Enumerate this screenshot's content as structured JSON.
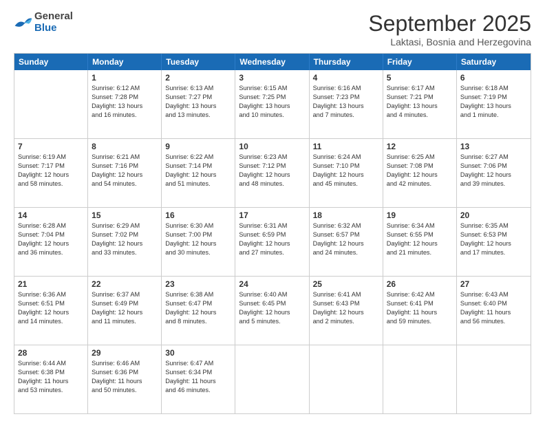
{
  "header": {
    "logo_general": "General",
    "logo_blue": "Blue",
    "month_title": "September 2025",
    "subtitle": "Laktasi, Bosnia and Herzegovina"
  },
  "weekdays": [
    "Sunday",
    "Monday",
    "Tuesday",
    "Wednesday",
    "Thursday",
    "Friday",
    "Saturday"
  ],
  "rows": [
    [
      {
        "day": "",
        "lines": []
      },
      {
        "day": "1",
        "lines": [
          "Sunrise: 6:12 AM",
          "Sunset: 7:28 PM",
          "Daylight: 13 hours",
          "and 16 minutes."
        ]
      },
      {
        "day": "2",
        "lines": [
          "Sunrise: 6:13 AM",
          "Sunset: 7:27 PM",
          "Daylight: 13 hours",
          "and 13 minutes."
        ]
      },
      {
        "day": "3",
        "lines": [
          "Sunrise: 6:15 AM",
          "Sunset: 7:25 PM",
          "Daylight: 13 hours",
          "and 10 minutes."
        ]
      },
      {
        "day": "4",
        "lines": [
          "Sunrise: 6:16 AM",
          "Sunset: 7:23 PM",
          "Daylight: 13 hours",
          "and 7 minutes."
        ]
      },
      {
        "day": "5",
        "lines": [
          "Sunrise: 6:17 AM",
          "Sunset: 7:21 PM",
          "Daylight: 13 hours",
          "and 4 minutes."
        ]
      },
      {
        "day": "6",
        "lines": [
          "Sunrise: 6:18 AM",
          "Sunset: 7:19 PM",
          "Daylight: 13 hours",
          "and 1 minute."
        ]
      }
    ],
    [
      {
        "day": "7",
        "lines": [
          "Sunrise: 6:19 AM",
          "Sunset: 7:17 PM",
          "Daylight: 12 hours",
          "and 58 minutes."
        ]
      },
      {
        "day": "8",
        "lines": [
          "Sunrise: 6:21 AM",
          "Sunset: 7:16 PM",
          "Daylight: 12 hours",
          "and 54 minutes."
        ]
      },
      {
        "day": "9",
        "lines": [
          "Sunrise: 6:22 AM",
          "Sunset: 7:14 PM",
          "Daylight: 12 hours",
          "and 51 minutes."
        ]
      },
      {
        "day": "10",
        "lines": [
          "Sunrise: 6:23 AM",
          "Sunset: 7:12 PM",
          "Daylight: 12 hours",
          "and 48 minutes."
        ]
      },
      {
        "day": "11",
        "lines": [
          "Sunrise: 6:24 AM",
          "Sunset: 7:10 PM",
          "Daylight: 12 hours",
          "and 45 minutes."
        ]
      },
      {
        "day": "12",
        "lines": [
          "Sunrise: 6:25 AM",
          "Sunset: 7:08 PM",
          "Daylight: 12 hours",
          "and 42 minutes."
        ]
      },
      {
        "day": "13",
        "lines": [
          "Sunrise: 6:27 AM",
          "Sunset: 7:06 PM",
          "Daylight: 12 hours",
          "and 39 minutes."
        ]
      }
    ],
    [
      {
        "day": "14",
        "lines": [
          "Sunrise: 6:28 AM",
          "Sunset: 7:04 PM",
          "Daylight: 12 hours",
          "and 36 minutes."
        ]
      },
      {
        "day": "15",
        "lines": [
          "Sunrise: 6:29 AM",
          "Sunset: 7:02 PM",
          "Daylight: 12 hours",
          "and 33 minutes."
        ]
      },
      {
        "day": "16",
        "lines": [
          "Sunrise: 6:30 AM",
          "Sunset: 7:00 PM",
          "Daylight: 12 hours",
          "and 30 minutes."
        ]
      },
      {
        "day": "17",
        "lines": [
          "Sunrise: 6:31 AM",
          "Sunset: 6:59 PM",
          "Daylight: 12 hours",
          "and 27 minutes."
        ]
      },
      {
        "day": "18",
        "lines": [
          "Sunrise: 6:32 AM",
          "Sunset: 6:57 PM",
          "Daylight: 12 hours",
          "and 24 minutes."
        ]
      },
      {
        "day": "19",
        "lines": [
          "Sunrise: 6:34 AM",
          "Sunset: 6:55 PM",
          "Daylight: 12 hours",
          "and 21 minutes."
        ]
      },
      {
        "day": "20",
        "lines": [
          "Sunrise: 6:35 AM",
          "Sunset: 6:53 PM",
          "Daylight: 12 hours",
          "and 17 minutes."
        ]
      }
    ],
    [
      {
        "day": "21",
        "lines": [
          "Sunrise: 6:36 AM",
          "Sunset: 6:51 PM",
          "Daylight: 12 hours",
          "and 14 minutes."
        ]
      },
      {
        "day": "22",
        "lines": [
          "Sunrise: 6:37 AM",
          "Sunset: 6:49 PM",
          "Daylight: 12 hours",
          "and 11 minutes."
        ]
      },
      {
        "day": "23",
        "lines": [
          "Sunrise: 6:38 AM",
          "Sunset: 6:47 PM",
          "Daylight: 12 hours",
          "and 8 minutes."
        ]
      },
      {
        "day": "24",
        "lines": [
          "Sunrise: 6:40 AM",
          "Sunset: 6:45 PM",
          "Daylight: 12 hours",
          "and 5 minutes."
        ]
      },
      {
        "day": "25",
        "lines": [
          "Sunrise: 6:41 AM",
          "Sunset: 6:43 PM",
          "Daylight: 12 hours",
          "and 2 minutes."
        ]
      },
      {
        "day": "26",
        "lines": [
          "Sunrise: 6:42 AM",
          "Sunset: 6:41 PM",
          "Daylight: 11 hours",
          "and 59 minutes."
        ]
      },
      {
        "day": "27",
        "lines": [
          "Sunrise: 6:43 AM",
          "Sunset: 6:40 PM",
          "Daylight: 11 hours",
          "and 56 minutes."
        ]
      }
    ],
    [
      {
        "day": "28",
        "lines": [
          "Sunrise: 6:44 AM",
          "Sunset: 6:38 PM",
          "Daylight: 11 hours",
          "and 53 minutes."
        ]
      },
      {
        "day": "29",
        "lines": [
          "Sunrise: 6:46 AM",
          "Sunset: 6:36 PM",
          "Daylight: 11 hours",
          "and 50 minutes."
        ]
      },
      {
        "day": "30",
        "lines": [
          "Sunrise: 6:47 AM",
          "Sunset: 6:34 PM",
          "Daylight: 11 hours",
          "and 46 minutes."
        ]
      },
      {
        "day": "",
        "lines": []
      },
      {
        "day": "",
        "lines": []
      },
      {
        "day": "",
        "lines": []
      },
      {
        "day": "",
        "lines": []
      }
    ]
  ]
}
